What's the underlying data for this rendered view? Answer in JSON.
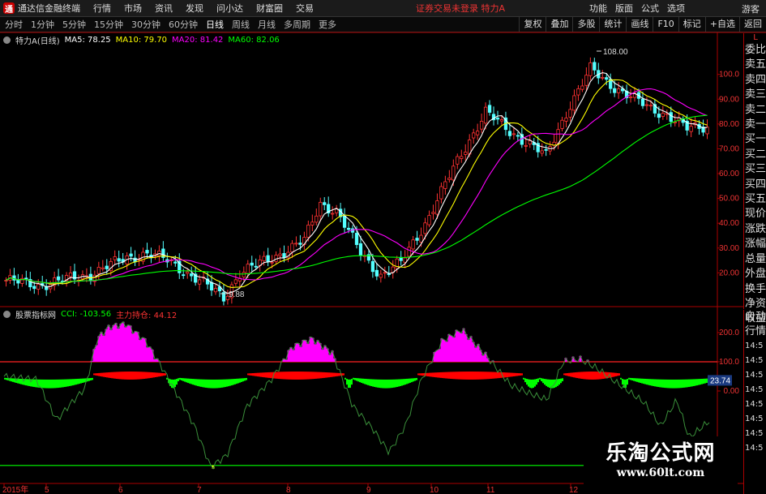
{
  "titlebar": {
    "app_title": "通达信金融终端",
    "menu": [
      "行情",
      "市场",
      "资讯",
      "发现",
      "问小达",
      "财富圈",
      "交易"
    ],
    "notice": "证券交易未登录  特力A",
    "right_menu": [
      "功能",
      "版面",
      "公式",
      "选项"
    ],
    "guest": "游客"
  },
  "toolbar": {
    "periods": [
      "分时",
      "1分钟",
      "5分钟",
      "15分钟",
      "30分钟",
      "60分钟",
      "日线",
      "周线",
      "月线",
      "多周期",
      "更多"
    ],
    "active_period": "日线",
    "right_buttons": [
      "复权",
      "叠加",
      "多股",
      "统计",
      "画线",
      "F10",
      "标记",
      "+自选",
      "返回"
    ]
  },
  "main_legend": {
    "stock": "特力A(日线)",
    "ma5": "MA5: 78.25",
    "ma10": "MA10: 79.70",
    "ma20": "MA20: 81.42",
    "ma60": "MA60: 82.06"
  },
  "indicator_legend": {
    "name": "股票指标网",
    "cci": "CCI: -103.56",
    "holding": "主力持仓: 44.12"
  },
  "price_axis": [
    "100.0",
    "90.00",
    "80.00",
    "70.00",
    "60.00",
    "50.00",
    "40.00",
    "30.00",
    "20.00"
  ],
  "indicator_axis": [
    "200.0",
    "100.0",
    "0.00"
  ],
  "indicator_value_tag": "23.74",
  "annotations": {
    "high": "108.00",
    "low": "9.88"
  },
  "date_axis": [
    "2015年",
    "5",
    "6",
    "7",
    "8",
    "9",
    "10",
    "11",
    "12"
  ],
  "side_panel": {
    "header": "L",
    "items": [
      "委比",
      "卖五",
      "卖四",
      "卖三",
      "卖二",
      "卖一",
      "买一",
      "买二",
      "买三",
      "买四",
      "买五",
      "现价",
      "涨跌",
      "涨幅",
      "总量",
      "外盘",
      "换手",
      "净资",
      "收益"
    ]
  },
  "side_panel2": {
    "tabs": [
      "自动",
      "行情"
    ],
    "times": [
      "14:5",
      "14:5",
      "14:5",
      "14:5",
      "14:5",
      "14:5",
      "14:5",
      "14:5"
    ]
  },
  "watermark": {
    "title": "乐淘公式网",
    "url": "www.60lt.com"
  },
  "colors": {
    "up": "#ff3232",
    "down": "#54ffff",
    "ma5": "#ffffff",
    "ma10": "#ffff00",
    "ma20": "#ff00ff",
    "ma60": "#00ff00",
    "pink": "#ff00ff",
    "red_band": "#ff0000",
    "green_band": "#00ff00",
    "yellow": "#ffff00"
  },
  "chart_data": {
    "type": "candlestick",
    "ma_series": [
      {
        "name": "MA5",
        "value": 78.25
      },
      {
        "name": "MA10",
        "value": 79.7
      },
      {
        "name": "MA20",
        "value": 81.42
      },
      {
        "name": "MA60",
        "value": 82.06
      }
    ],
    "ylim": [
      9,
      112
    ],
    "indicator": {
      "name": "CCI",
      "value": -103.56,
      "ylim": [
        -300,
        250
      ]
    }
  }
}
